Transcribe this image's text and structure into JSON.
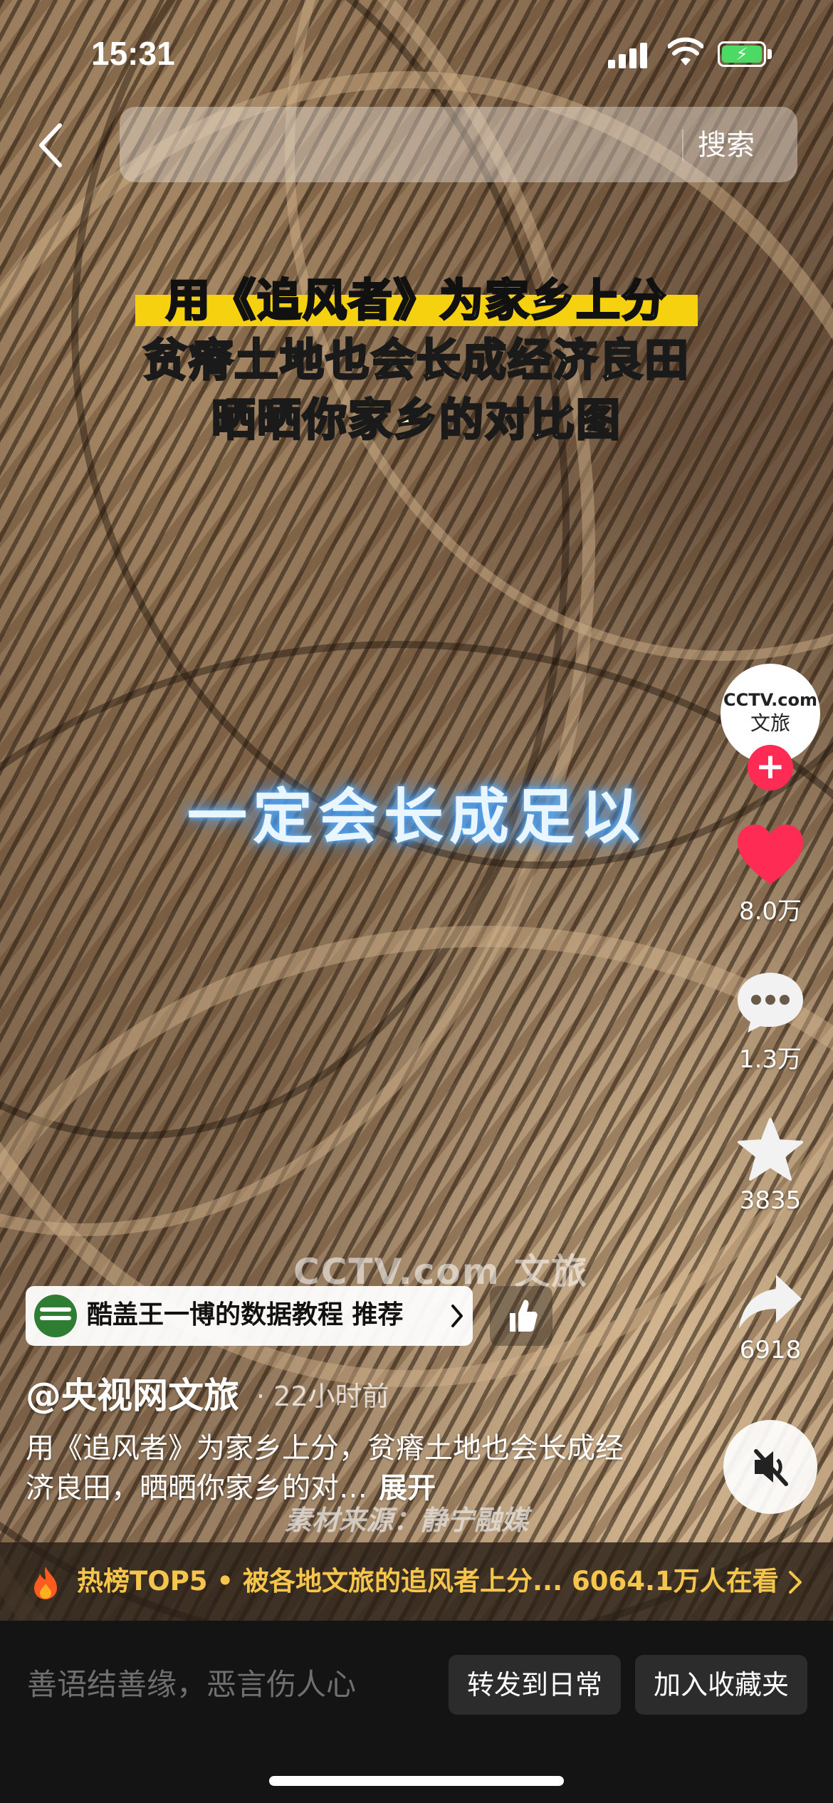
{
  "status_bar": {
    "time": "15:31"
  },
  "search": {
    "button_label": "搜索"
  },
  "video": {
    "caption_lines": [
      "用《追风者》为家乡上分",
      "贫瘠土地也会长成经济良田",
      "晒晒你家乡的对比图"
    ],
    "subtitle": "一定会长成足以",
    "watermark": "CCTV.com 文旅",
    "source": "素材来源：静宁融媒"
  },
  "rail": {
    "avatar_logo": "CCTV.com",
    "avatar_sub": "文旅",
    "follow_label": "+",
    "likes": "8.0万",
    "comments": "1.3万",
    "favorites": "3835",
    "shares": "6918",
    "like_color": "#fe2c55"
  },
  "recommendation": {
    "label": "酷盖王一博的数据教程 推荐"
  },
  "post": {
    "author": "@央视网文旅",
    "time": "· 22小时前",
    "description": "用《追风者》为家乡上分，贫瘠土地也会长成经济良田，晒晒你家乡的对…",
    "expand_label": "展开"
  },
  "hot": {
    "text": "热榜TOP5 • 被各地文旅的追风者上分... 6064.1万人在看",
    "accent": "#f5c64b"
  },
  "bottom": {
    "comment_placeholder": "善语结善缘，恶言伤人心",
    "forward_label": "转发到日常",
    "collect_label": "加入收藏夹"
  }
}
